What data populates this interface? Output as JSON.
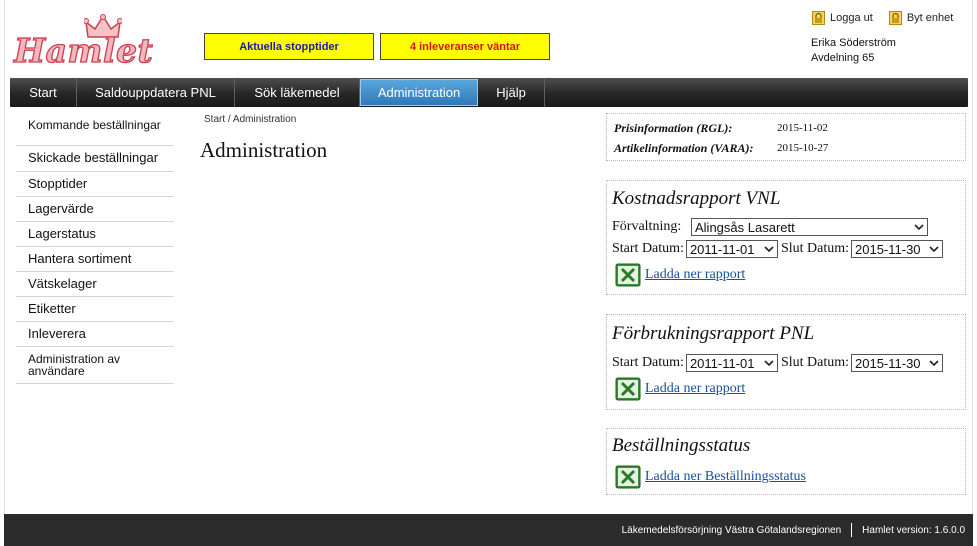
{
  "header": {
    "logo_text": "Hamlet",
    "alert_stop": "Aktuella stopptider",
    "alert_delivery": "4 inleveranser väntar",
    "logout": "Logga ut",
    "switch_unit": "Byt enhet",
    "user_name": "Erika Söderström",
    "user_unit": "Avdelning 65"
  },
  "nav": [
    "Start",
    "Saldouppdatera PNL",
    "Sök läkemedel",
    "Administration",
    "Hjälp"
  ],
  "sidebar": [
    "Kommande beställningar",
    "Skickade beställningar",
    "Stopptider",
    "Lagervärde",
    "Lagerstatus",
    "Hantera sortiment",
    "Vätskelager",
    "Etiketter",
    "Inleverera",
    "Administration av användare"
  ],
  "breadcrumb": {
    "home": "Start",
    "sep": " / ",
    "current": "Administration"
  },
  "page_title": "Administration",
  "info": {
    "price_label": "Prisinformation (RGL):",
    "price_date": "2015-11-02",
    "article_label": "Artikelinformation (VARA):",
    "article_date": "2015-10-27"
  },
  "cost_report": {
    "title": "Kostnadsrapport VNL",
    "admin_label": "Förvaltning:",
    "admin_value": "Alingsås Lasarett",
    "start_label": "Start Datum:",
    "start_value": "2011-11-01",
    "end_label": "Slut Datum:",
    "end_value": "2015-11-30",
    "download": "Ladda ner rapport"
  },
  "usage_report": {
    "title": "Förbrukningsrapport PNL",
    "start_label": "Start Datum:",
    "start_value": "2011-11-01",
    "end_label": "Slut Datum:",
    "end_value": "2015-11-30",
    "download": "Ladda ner rapport"
  },
  "order_status": {
    "title": "Beställningsstatus",
    "download": "Ladda ner Beställningsstatus"
  },
  "footer": {
    "org": "Läkemedelsförsörjning Västra Götalandsregionen",
    "version": "Hamlet version: 1.6.0.0"
  },
  "colors": {
    "alert_bg": "#ffff00",
    "nav_active": "#3a86c8",
    "link": "#1a4fa3"
  },
  "icons": [
    "lock-icon",
    "excel-icon",
    "chevron-down-icon",
    "crown-icon"
  ]
}
